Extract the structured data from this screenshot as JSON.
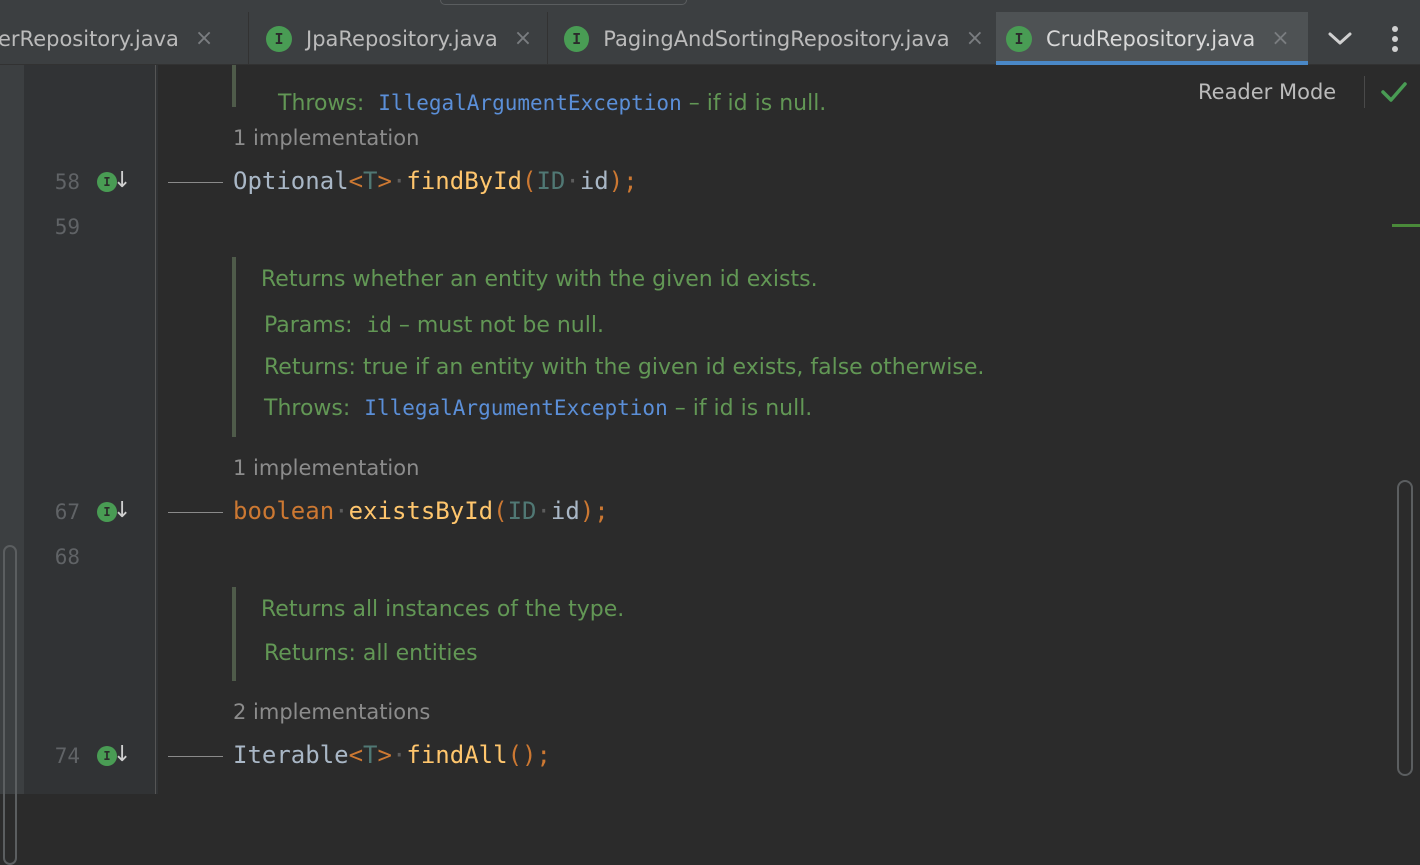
{
  "tabs": [
    {
      "label": "erRepository.java",
      "icon": "I",
      "active": false
    },
    {
      "label": "JpaRepository.java",
      "icon": "I",
      "active": false
    },
    {
      "label": "PagingAndSortingRepository.java",
      "icon": "I",
      "active": false
    },
    {
      "label": "CrudRepository.java",
      "icon": "I",
      "active": true
    }
  ],
  "tab_close_glyph": "×",
  "toolbar": {
    "reader_mode": "Reader Mode"
  },
  "gutter": {
    "line_58": "58",
    "line_59": "59",
    "line_67": "67",
    "line_68": "68",
    "line_74": "74",
    "impl_icon_letter": "I"
  },
  "doc_top": {
    "tag": "Throws:",
    "link": "IllegalArgumentException",
    "text": " – if id is null."
  },
  "findById": {
    "impl_hint": "1 implementation",
    "type": "Optional",
    "generic_open": "<",
    "generic_T": "T",
    "generic_close": ">",
    "method": "findById",
    "paren_open": "(",
    "param_type": "ID",
    "param_name": "id",
    "paren_close": ")",
    "semi": ";"
  },
  "doc_exists": {
    "summary": "Returns whether an entity with the given id exists.",
    "params_tag": "Params:",
    "params_name": "id",
    "params_text": " – must not be null.",
    "returns_tag": "Returns:",
    "returns_text": "true if an entity with the given id exists, false otherwise.",
    "throws_tag": "Throws:",
    "throws_link": "IllegalArgumentException",
    "throws_text": " – if id is null."
  },
  "existsById": {
    "impl_hint": "1 implementation",
    "keyword": "boolean",
    "method": "existsById",
    "paren_open": "(",
    "param_type": "ID",
    "param_name": "id",
    "paren_close": ")",
    "semi": ";"
  },
  "doc_findall": {
    "summary": "Returns all instances of the type.",
    "returns_tag": "Returns:",
    "returns_text": "all entities"
  },
  "findAll": {
    "impl_hint": "2 implementations",
    "type": "Iterable",
    "generic_open": "<",
    "generic_T": "T",
    "generic_close": ">",
    "method": "findAll",
    "parens": "()",
    "semi": ";"
  },
  "colors": {
    "accent": "#4a88c7",
    "doc": "#629755",
    "method": "#ffc66d",
    "keyword": "#cc7832"
  }
}
